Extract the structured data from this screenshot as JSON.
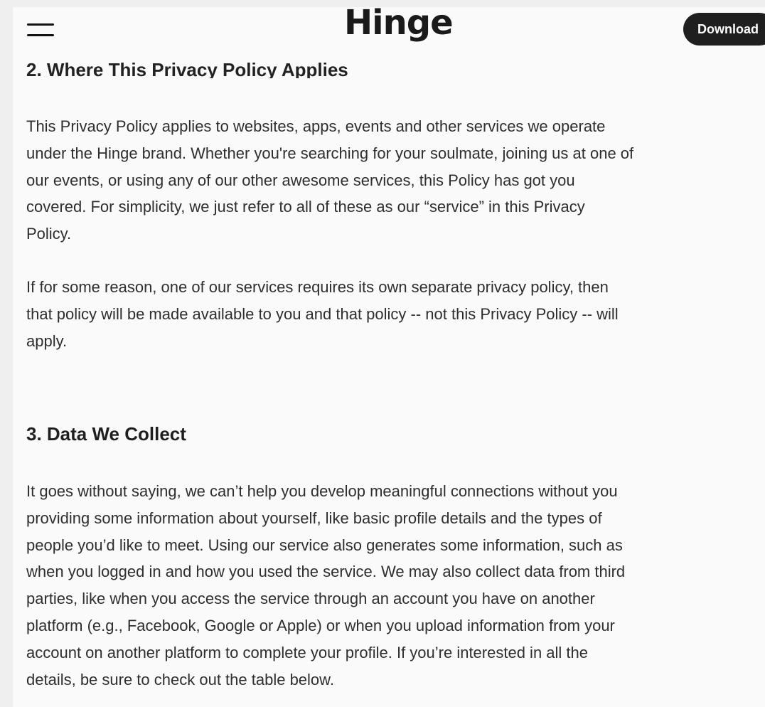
{
  "header": {
    "logo": "Hinge",
    "download_label": "Download",
    "menu_icon": "hamburger-menu-icon"
  },
  "sections": {
    "s2_heading": "2. Where This Privacy Policy Applies",
    "s2_p1_lines": [
      "This Privacy Policy applies to websites, apps, events and other services we operate",
      "under the Hinge brand. Whether you're searching for your soulmate, joining us at one of",
      "our events, or using any of our other awesome services, this Policy has got you",
      "covered. For simplicity, we just refer to all of these as our “service” in this Privacy",
      "Policy."
    ],
    "s2_p2_lines": [
      "If for some reason, one of our services requires its own separate privacy policy, then",
      "that policy will be made available to you and that policy -- not this Privacy Policy -- will",
      "apply."
    ],
    "s3_heading": "3. Data We Collect",
    "s3_p1_lines": [
      "It goes without saying, we can’t help you develop meaningful connections without you",
      "providing some information about yourself, like basic profile details and the types of",
      "people you’d like to meet. Using our service also generates some information, such as",
      "when you logged in and how you used the service. We may also collect data from third",
      "parties, like when you access the service through an account you have on another",
      "platform (e.g., Facebook, Google or Apple) or when you upload information from your",
      "account on another platform to complete your profile. If you’re interested in all the",
      "details, be sure to check out the table below."
    ]
  }
}
